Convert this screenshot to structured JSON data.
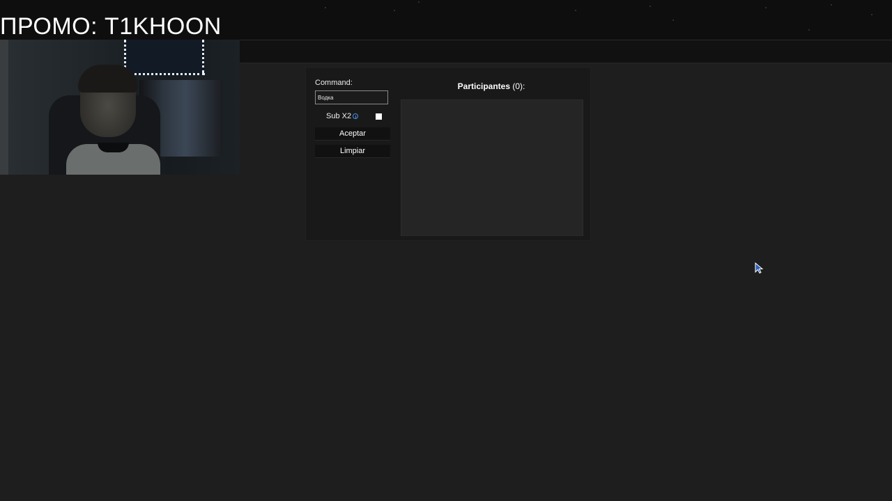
{
  "overlay": {
    "promo_text": "ПРОМО: T1KHOON"
  },
  "panel": {
    "command_label": "Command:",
    "command_value": "Водка",
    "sub_label": "Sub X2",
    "sub_checked": false,
    "accept_label": "Aceptar",
    "clear_label": "Limpiar",
    "participants_label": "Participantes",
    "participants_count": "(0):"
  },
  "colors": {
    "background": "#1e1e1e",
    "panel": "#191919",
    "list": "#252525",
    "info_accent": "#4a90e2"
  },
  "icons": {
    "info": "info-icon",
    "cursor": "mouse-cursor-icon"
  }
}
